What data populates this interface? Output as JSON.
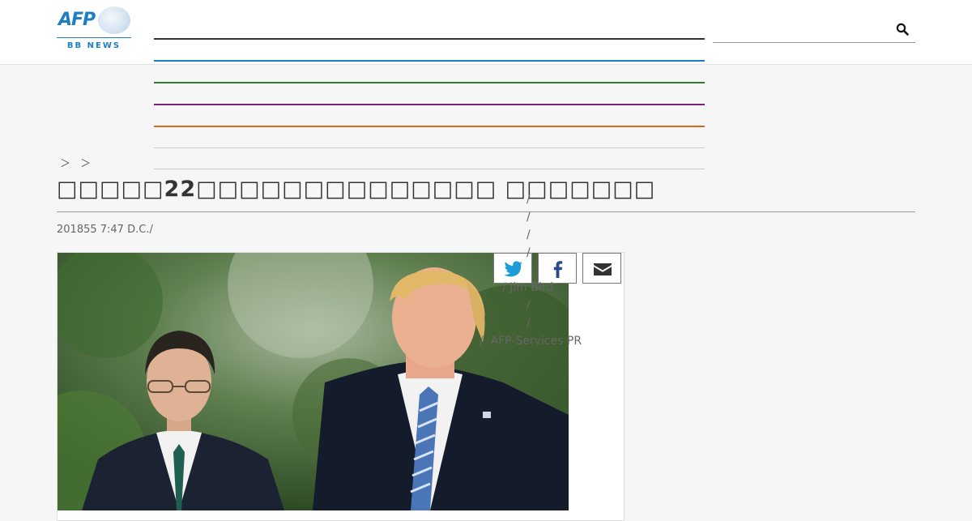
{
  "header": {
    "logo": {
      "brand": "AFP",
      "sub": "BB NEWS"
    },
    "search": {
      "placeholder": ""
    },
    "nav_colors": [
      "#333333",
      "#1d7ec2",
      "#2e7d32",
      "#7b1f7b",
      "#d2691e",
      "#cccccc",
      "#cccccc"
    ]
  },
  "breadcrumb": {
    "text": "＞ ＞"
  },
  "article": {
    "headline": "□□□□□22□□□□□□□□□□□□□□ □□□□□□□",
    "date": "201855 7:47",
    "source": "D.C./",
    "credit_separators": [
      "/",
      "/",
      "/",
      "/",
      "/",
      "/"
    ],
    "credit_name": "Jim Bird",
    "credit_service": "AFP-Services PR"
  },
  "share": {
    "twitter": "twitter-icon",
    "facebook": "facebook-icon",
    "email": "envelope-icon"
  }
}
